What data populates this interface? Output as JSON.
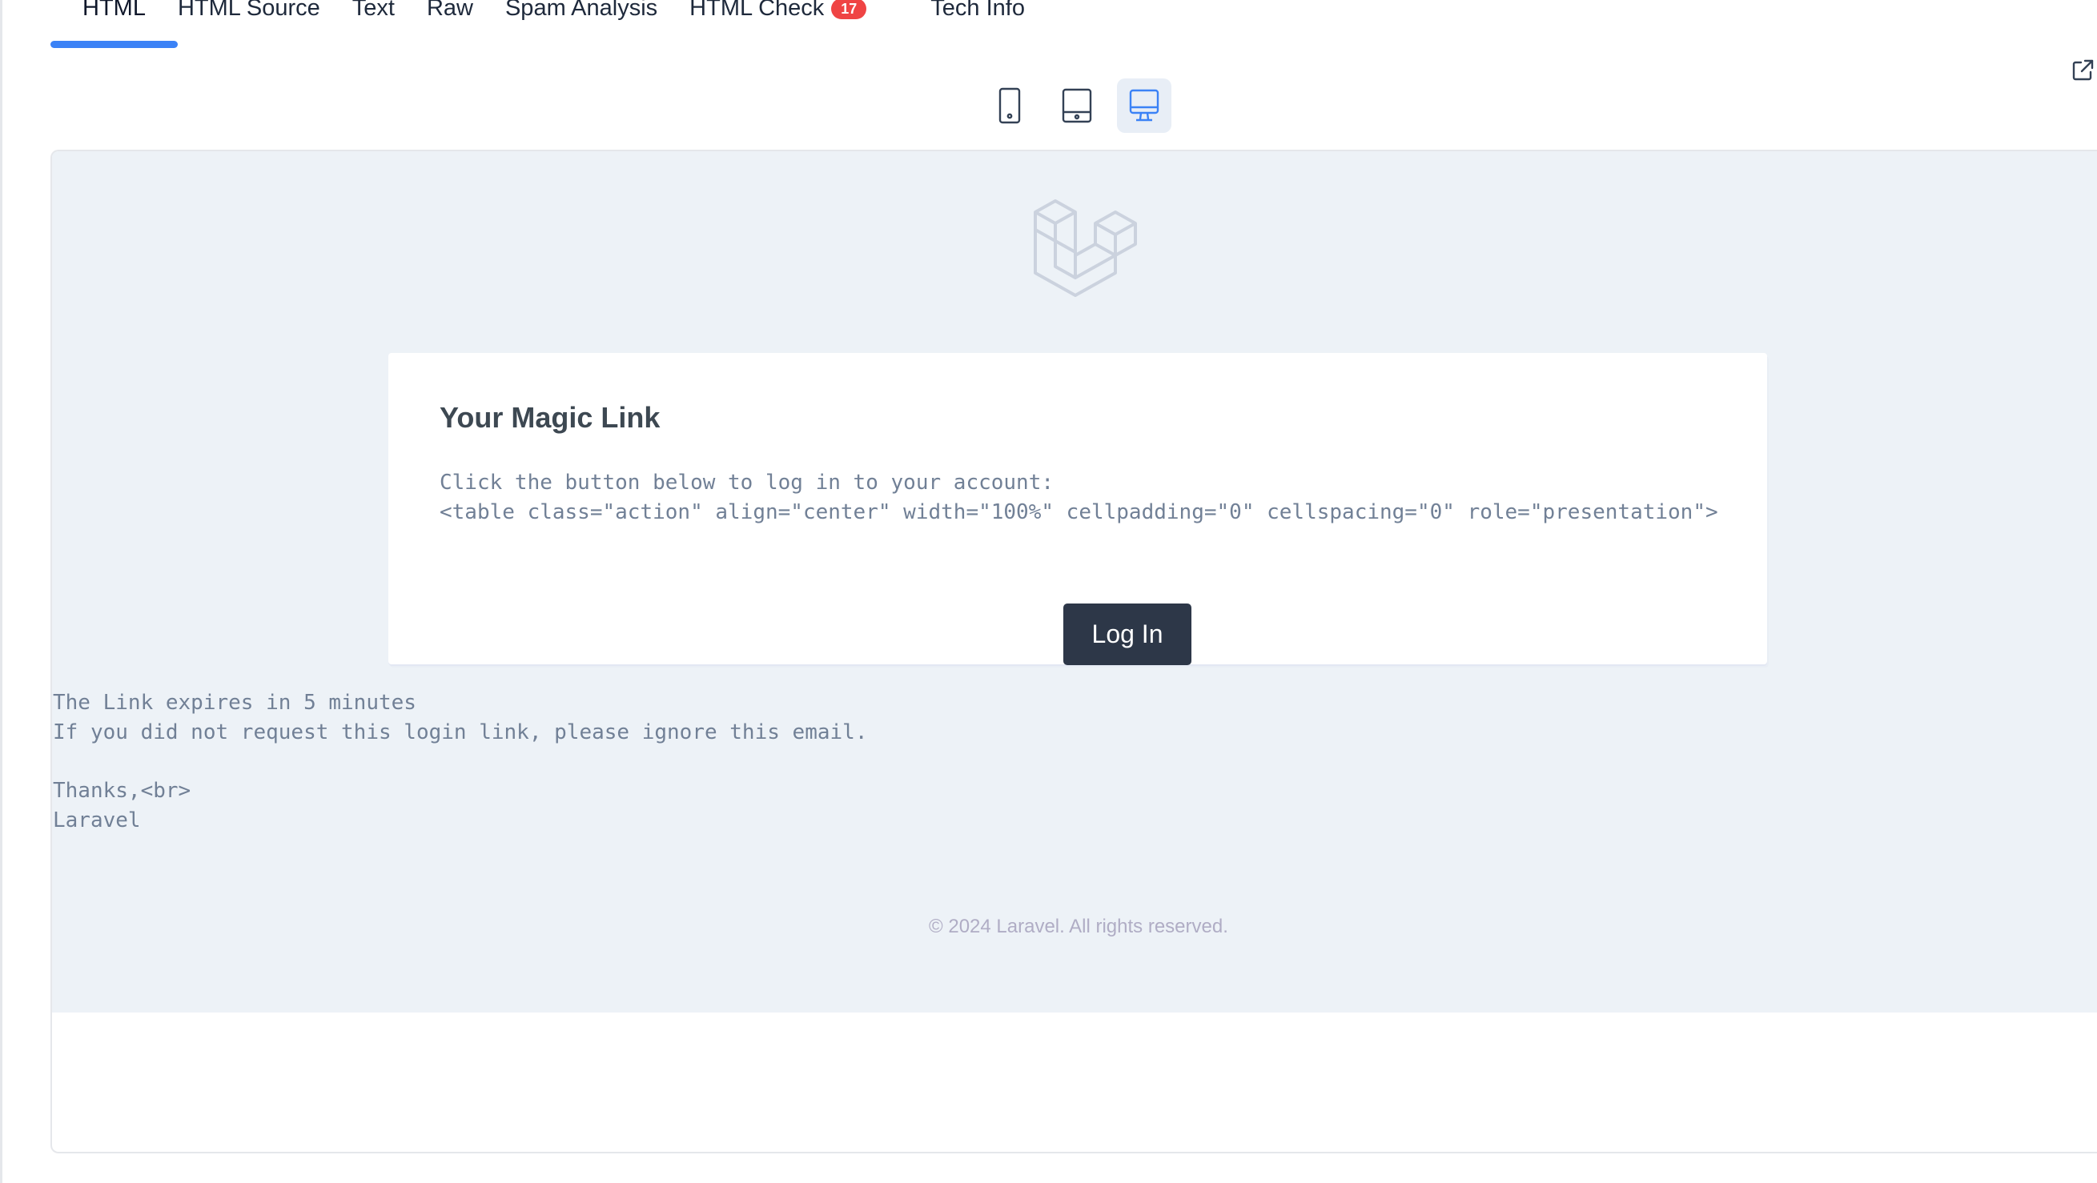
{
  "tabs": [
    {
      "label": "HTML",
      "active": true
    },
    {
      "label": "HTML Source",
      "active": false
    },
    {
      "label": "Text",
      "active": false
    },
    {
      "label": "Raw",
      "active": false
    },
    {
      "label": "Spam Analysis",
      "active": false
    },
    {
      "label": "HTML Check",
      "active": false,
      "badge": "17"
    },
    {
      "label": "Tech Info",
      "active": false
    }
  ],
  "device_toggles": [
    {
      "name": "mobile-icon",
      "active": false
    },
    {
      "name": "tablet-icon",
      "active": false
    },
    {
      "name": "desktop-icon",
      "active": true
    }
  ],
  "colors": {
    "accent": "#3b82f6",
    "badge": "#ef4444",
    "email_background": "#edf2f7",
    "button": "#2d3748"
  },
  "email": {
    "title": "Your Magic Link",
    "intro": "Click the button below to log in to your account:",
    "raw_table_tag": "<table class=\"action\" align=\"center\" width=\"100%\" cellpadding=\"0\" cellspacing=\"0\" role=\"presentation\">",
    "button_label": "Log In",
    "expires": "The Link expires in 5 minutes",
    "ignore": "If you did not request this login link, please ignore this email.",
    "thanks": "Thanks,<br>",
    "signature": "Laravel",
    "copyright": "© 2024 Laravel. All rights reserved."
  }
}
